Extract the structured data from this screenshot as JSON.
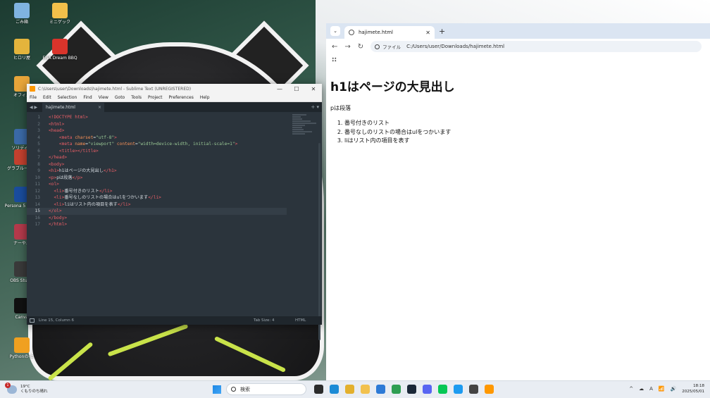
{
  "desktop": {
    "icons": [
      {
        "label": "ごみ箱",
        "color": "#7fb3e0"
      },
      {
        "label": "ミニゲック",
        "color": "#f2c04a"
      },
      {
        "label": "ヒロリ屋",
        "color": "#e4b43c"
      },
      {
        "label": "ENA Dream BBQ",
        "color": "#d9342b"
      },
      {
        "label": "オフィス",
        "color": "#e8a53a"
      },
      {
        "label": "ソリディア",
        "color": "#3b6aa8"
      },
      {
        "label": "グラブルーゲー",
        "color": "#c4412f"
      },
      {
        "label": "Persona 5 FINAL",
        "color": "#1a4d9e"
      },
      {
        "label": "ナーやん",
        "color": "#b53a4b"
      },
      {
        "label": "OBS Studio",
        "color": "#3a3a3a"
      },
      {
        "label": "Canva",
        "color": "#111111"
      },
      {
        "label": "Pythonの-と",
        "color": "#f0a020"
      }
    ]
  },
  "sublime": {
    "title": "C:\\Users\\user\\Downloads\\hajimete.html - Sublime Text (UNREGISTERED)",
    "window_controls": [
      "—",
      "☐",
      "✕"
    ],
    "menu": [
      "File",
      "Edit",
      "Selection",
      "Find",
      "View",
      "Goto",
      "Tools",
      "Project",
      "Preferences",
      "Help"
    ],
    "tab_arrows": "◀ ▶",
    "tab": {
      "label": "hajimete.html",
      "close": "×"
    },
    "tab_right": "+ ▾",
    "active_line": 15,
    "status": {
      "position": "Line 15, Column 6",
      "tab_size": "Tab Size: 4",
      "syntax": "HTML"
    }
  },
  "chrome": {
    "tab_title": "hajimete.html",
    "tab_close": "✕",
    "new_tab": "+",
    "dropdown": "⌄",
    "nav": {
      "back": "←",
      "forward": "→",
      "reload": "↻"
    },
    "address_chip": "ファイル",
    "address": "C:/Users/user/Downloads/hajimete.html",
    "page": {
      "h1": "h1はページの大見出し",
      "p": "pは段落",
      "list": [
        "番号付きのリスト",
        "番号なしのリストの場合はulをつかいます",
        "liはリスト内の項目を表す"
      ]
    }
  },
  "taskbar": {
    "weather": {
      "temp": "19°C",
      "desc": "くもりのち晴れ",
      "badge": "1"
    },
    "search_placeholder": "検索",
    "apps": [
      {
        "name": "task-view",
        "color": "#2b2b2b"
      },
      {
        "name": "edge",
        "color": "#1c8bd6"
      },
      {
        "name": "chrome",
        "color": "#e3b02d"
      },
      {
        "name": "explorer",
        "color": "#f2c14e"
      },
      {
        "name": "store",
        "color": "#2d7ad6"
      },
      {
        "name": "play",
        "color": "#2e9e52"
      },
      {
        "name": "steam",
        "color": "#1b2838"
      },
      {
        "name": "discord",
        "color": "#5865f2"
      },
      {
        "name": "line",
        "color": "#06c755"
      },
      {
        "name": "twitter",
        "color": "#1d9bf0"
      },
      {
        "name": "media",
        "color": "#444444"
      },
      {
        "name": "sublime",
        "color": "#ff9800"
      }
    ],
    "tray": [
      "^",
      "☁",
      "A",
      "📶",
      "🔊"
    ],
    "time": "18:18",
    "date": "2025/05/01"
  }
}
